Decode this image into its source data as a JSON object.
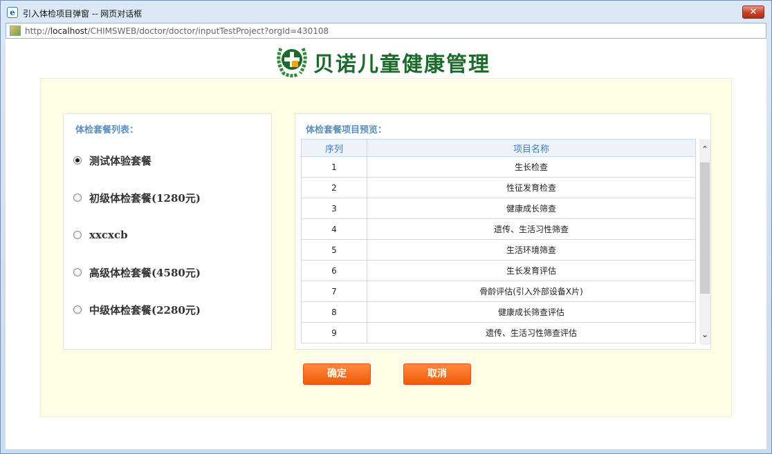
{
  "window": {
    "title": "引入体检项目弹窗 -- 网页对话框",
    "close_label": "✕",
    "title_icon": "e"
  },
  "address": {
    "prefix": "http://",
    "host": "localhost",
    "path": "/CHIMSWEB/doctor/doctor/inputTestProject?orgId=430108"
  },
  "logo": {
    "text": "贝诺儿童健康管理"
  },
  "package_list": {
    "title": "体检套餐列表：",
    "items": [
      {
        "label": "测试体验套餐",
        "checked": true
      },
      {
        "label": "初级体检套餐(1280元)",
        "checked": false
      },
      {
        "label": "xxcxcb",
        "checked": false
      },
      {
        "label": "高级体检套餐(4580元)",
        "checked": false
      },
      {
        "label": "中级体检套餐(2280元)",
        "checked": false
      }
    ]
  },
  "preview": {
    "title": "体检套餐项目预览：",
    "columns": [
      "序列",
      "项目名称"
    ],
    "rows": [
      [
        "1",
        "生长检查"
      ],
      [
        "2",
        "性征发育检查"
      ],
      [
        "3",
        "健康成长筛查"
      ],
      [
        "4",
        "遗传、生活习性筛查"
      ],
      [
        "5",
        "生活环境筛查"
      ],
      [
        "6",
        "生长发育评估"
      ],
      [
        "7",
        "骨龄评估(引入外部设备X片)"
      ],
      [
        "8",
        "健康成长筛查评估"
      ],
      [
        "9",
        "遗传、生活习性筛查评估"
      ]
    ]
  },
  "buttons": {
    "ok": "确定",
    "cancel": "取消"
  },
  "colors": {
    "accent": "#f05a0a",
    "panel_bg": "#fefde6",
    "logo_green": "#1c6b2c"
  }
}
